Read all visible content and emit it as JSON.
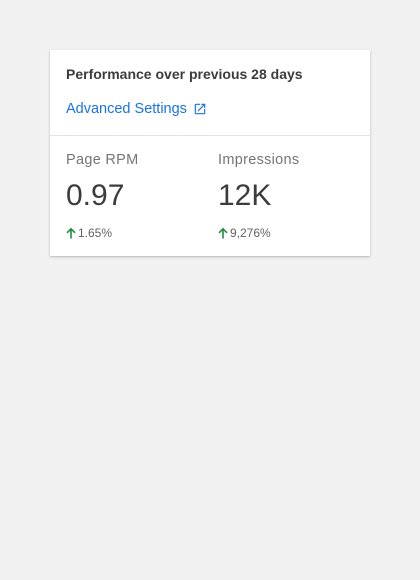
{
  "card": {
    "title": "Performance over previous 28 days",
    "settings_link": "Advanced Settings"
  },
  "metrics": [
    {
      "label": "Page RPM",
      "value": "0.97",
      "change": "1.65%",
      "direction": "up"
    },
    {
      "label": "Impressions",
      "value": "12K",
      "change": "9,276%",
      "direction": "up"
    }
  ],
  "icons": {
    "external_link": "external-link-icon",
    "trend_up": "arrow-up-icon"
  },
  "colors": {
    "link": "#1a73e8",
    "positive": "#1e8e3e",
    "background": "#f1f1f1"
  }
}
